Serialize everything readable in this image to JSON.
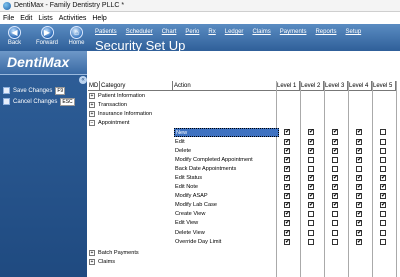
{
  "window": {
    "title": "DentiMax - Family Dentistry PLLC *"
  },
  "menu": [
    "File",
    "Edit",
    "Lists",
    "Activities",
    "Help"
  ],
  "nav": {
    "back": "Back",
    "forward": "Forward",
    "home": "Home"
  },
  "toplinks": [
    "Patients",
    "Scheduler",
    "Chart",
    "Perio",
    "Rx",
    "Ledger",
    "Claims",
    "Payments",
    "Reports",
    "Setup"
  ],
  "page_title": "Security Set Up",
  "logo": "DentiMax",
  "sidebar": {
    "save_label": "Save Changes",
    "save_key": "F9",
    "cancel_label": "Cancel Changes",
    "cancel_key": "ESC"
  },
  "grid": {
    "columns": [
      "MD",
      "Category",
      "Action",
      "Level 1",
      "Level 2",
      "Level 3",
      "Level 4",
      "Level 5"
    ],
    "categories": [
      {
        "label": "Patient Information",
        "expanded": false
      },
      {
        "label": "Transaction",
        "expanded": false
      },
      {
        "label": "Insurance Information",
        "expanded": false
      },
      {
        "label": "Appointment",
        "expanded": true
      }
    ],
    "actions": [
      {
        "label": "New",
        "selected": true,
        "levels": [
          true,
          true,
          true,
          true,
          false
        ]
      },
      {
        "label": "Edit",
        "selected": false,
        "levels": [
          true,
          true,
          true,
          true,
          false
        ]
      },
      {
        "label": "Delete",
        "selected": false,
        "levels": [
          true,
          true,
          true,
          true,
          false
        ]
      },
      {
        "label": "Modify Completed Appointment",
        "selected": false,
        "levels": [
          true,
          false,
          false,
          true,
          false
        ]
      },
      {
        "label": "Back Date Appointments",
        "selected": false,
        "levels": [
          true,
          false,
          false,
          false,
          false
        ]
      },
      {
        "label": "Edit Status",
        "selected": false,
        "levels": [
          true,
          true,
          true,
          true,
          true
        ]
      },
      {
        "label": "Edit Note",
        "selected": false,
        "levels": [
          true,
          true,
          true,
          true,
          true
        ]
      },
      {
        "label": "Modify ASAP",
        "selected": false,
        "levels": [
          true,
          true,
          true,
          true,
          true
        ]
      },
      {
        "label": "Modify Lab Case",
        "selected": false,
        "levels": [
          true,
          true,
          true,
          true,
          true
        ]
      },
      {
        "label": "Create View",
        "selected": false,
        "levels": [
          true,
          false,
          false,
          true,
          false
        ]
      },
      {
        "label": "Edit View",
        "selected": false,
        "levels": [
          true,
          false,
          false,
          true,
          false
        ]
      },
      {
        "label": "Delete View",
        "selected": false,
        "levels": [
          true,
          false,
          false,
          true,
          false
        ]
      },
      {
        "label": "Override Day Limit",
        "selected": false,
        "levels": [
          true,
          false,
          false,
          true,
          false
        ]
      }
    ],
    "trailing_categories": [
      {
        "label": "Batch Payments",
        "expanded": false
      },
      {
        "label": "Claims",
        "expanded": false
      }
    ]
  }
}
